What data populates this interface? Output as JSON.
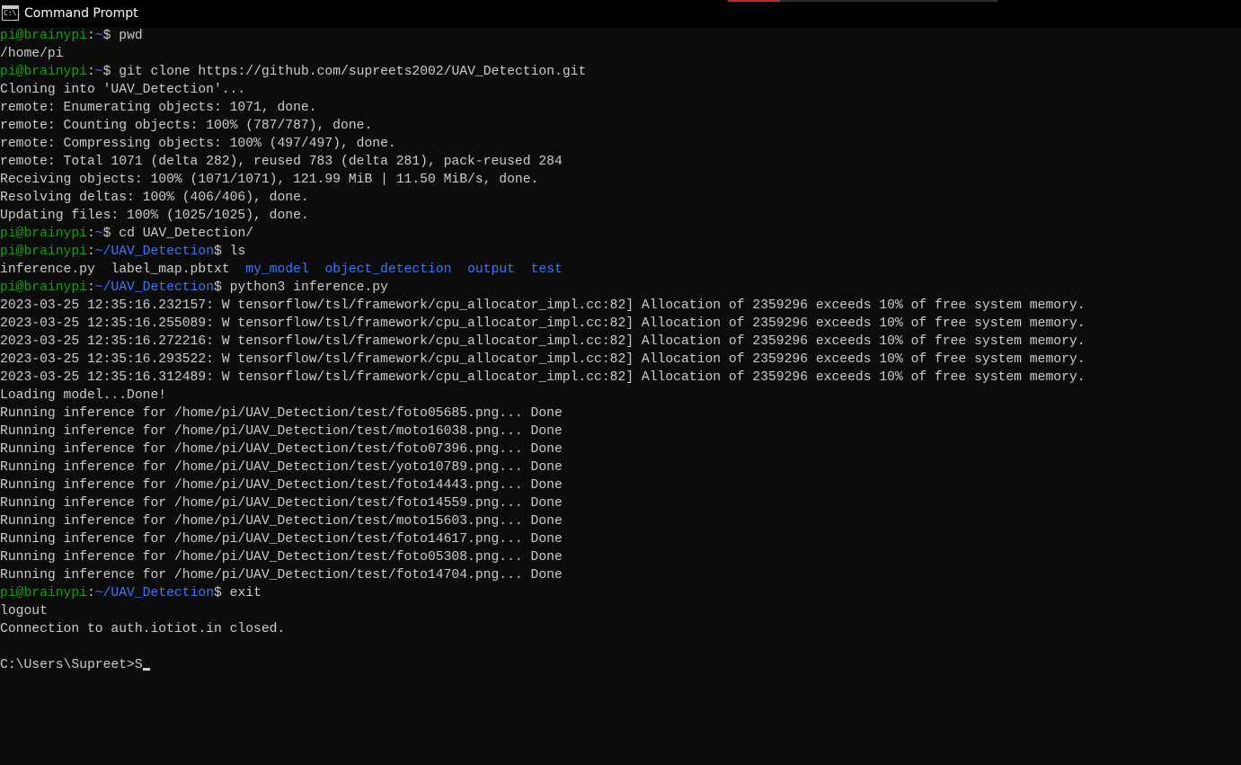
{
  "window": {
    "title": "Command Prompt",
    "icon_glyph": "C:\\."
  },
  "terminal": {
    "lines": [
      {
        "type": "prompt",
        "user": "pi@brainypi",
        "path": "~",
        "command": "pwd"
      },
      {
        "type": "out",
        "text": "/home/pi"
      },
      {
        "type": "prompt",
        "user": "pi@brainypi",
        "path": "~",
        "command": "git clone https://github.com/supreets2002/UAV_Detection.git"
      },
      {
        "type": "out",
        "text": "Cloning into 'UAV_Detection'..."
      },
      {
        "type": "out",
        "text": "remote: Enumerating objects: 1071, done."
      },
      {
        "type": "out",
        "text": "remote: Counting objects: 100% (787/787), done."
      },
      {
        "type": "out",
        "text": "remote: Compressing objects: 100% (497/497), done."
      },
      {
        "type": "out",
        "text": "remote: Total 1071 (delta 282), reused 783 (delta 281), pack-reused 284"
      },
      {
        "type": "out",
        "text": "Receiving objects: 100% (1071/1071), 121.99 MiB | 11.50 MiB/s, done."
      },
      {
        "type": "out",
        "text": "Resolving deltas: 100% (406/406), done."
      },
      {
        "type": "out",
        "text": "Updating files: 100% (1025/1025), done."
      },
      {
        "type": "prompt",
        "user": "pi@brainypi",
        "path": "~",
        "command": "cd UAV_Detection/"
      },
      {
        "type": "prompt",
        "user": "pi@brainypi",
        "path": "~/UAV_Detection",
        "command": "ls"
      },
      {
        "type": "ls",
        "files": [
          "inference.py",
          "label_map.pbtxt"
        ],
        "dirs": [
          "my_model",
          "object_detection",
          "output",
          "test"
        ]
      },
      {
        "type": "prompt",
        "user": "pi@brainypi",
        "path": "~/UAV_Detection",
        "command": "python3 inference.py"
      },
      {
        "type": "out",
        "text": "2023-03-25 12:35:16.232157: W tensorflow/tsl/framework/cpu_allocator_impl.cc:82] Allocation of 2359296 exceeds 10% of free system memory."
      },
      {
        "type": "out",
        "text": "2023-03-25 12:35:16.255089: W tensorflow/tsl/framework/cpu_allocator_impl.cc:82] Allocation of 2359296 exceeds 10% of free system memory."
      },
      {
        "type": "out",
        "text": "2023-03-25 12:35:16.272216: W tensorflow/tsl/framework/cpu_allocator_impl.cc:82] Allocation of 2359296 exceeds 10% of free system memory."
      },
      {
        "type": "out",
        "text": "2023-03-25 12:35:16.293522: W tensorflow/tsl/framework/cpu_allocator_impl.cc:82] Allocation of 2359296 exceeds 10% of free system memory."
      },
      {
        "type": "out",
        "text": "2023-03-25 12:35:16.312489: W tensorflow/tsl/framework/cpu_allocator_impl.cc:82] Allocation of 2359296 exceeds 10% of free system memory."
      },
      {
        "type": "out",
        "text": "Loading model...Done!"
      },
      {
        "type": "out",
        "text": "Running inference for /home/pi/UAV_Detection/test/foto05685.png... Done"
      },
      {
        "type": "out",
        "text": "Running inference for /home/pi/UAV_Detection/test/moto16038.png... Done"
      },
      {
        "type": "out",
        "text": "Running inference for /home/pi/UAV_Detection/test/foto07396.png... Done"
      },
      {
        "type": "out",
        "text": "Running inference for /home/pi/UAV_Detection/test/yoto10789.png... Done"
      },
      {
        "type": "out",
        "text": "Running inference for /home/pi/UAV_Detection/test/foto14443.png... Done"
      },
      {
        "type": "out",
        "text": "Running inference for /home/pi/UAV_Detection/test/foto14559.png... Done"
      },
      {
        "type": "out",
        "text": "Running inference for /home/pi/UAV_Detection/test/moto15603.png... Done"
      },
      {
        "type": "out",
        "text": "Running inference for /home/pi/UAV_Detection/test/foto14617.png... Done"
      },
      {
        "type": "out",
        "text": "Running inference for /home/pi/UAV_Detection/test/foto05308.png... Done"
      },
      {
        "type": "out",
        "text": "Running inference for /home/pi/UAV_Detection/test/foto14704.png... Done"
      },
      {
        "type": "prompt",
        "user": "pi@brainypi",
        "path": "~/UAV_Detection",
        "command": "exit"
      },
      {
        "type": "out",
        "text": "logout"
      },
      {
        "type": "out",
        "text": "Connection to auth.iotiot.in closed."
      },
      {
        "type": "out",
        "text": ""
      },
      {
        "type": "cmd",
        "prompt": "C:\\Users\\Supreet>",
        "input": "S"
      }
    ]
  },
  "colors": {
    "background": "#0c0c0c",
    "text": "#cccccc",
    "user": "#13a10e",
    "path": "#3b78ff"
  }
}
